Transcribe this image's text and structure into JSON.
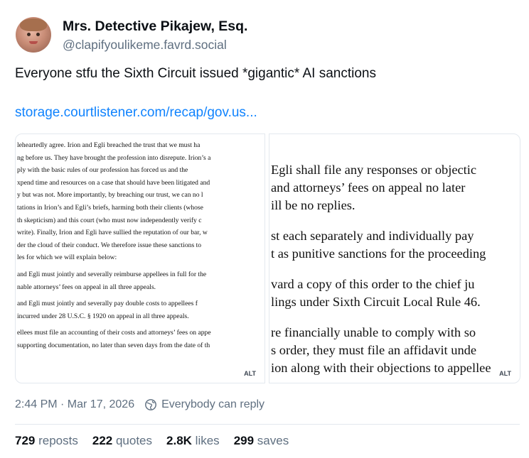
{
  "author": {
    "display_name": "Mrs. Detective Pikajew, Esq.",
    "handle": "@clapifyoulikeme.favrd.social",
    "avatar_icon": "avatar-photo"
  },
  "post": {
    "text": "Everyone stfu the Sixth Circuit issued *gigantic* AI sanctions",
    "link": "storage.courtlistener.com/recap/gov.us..."
  },
  "images": [
    {
      "alt_label": "ALT",
      "lines": [
        "leheartedly agree.  Irion and Egli breached the trust that we must ha",
        "ng before us.  They have brought the profession into disrepute.  Irion’s a",
        "ply with the basic rules of our profession has forced us and the",
        "xpend time and resources on a case that should have been litigated and",
        "y but was not.  More importantly, by breaching our trust, we can no l",
        "tations in Irion’s and Egli’s briefs, harming both their clients (whose",
        "th skepticism) and this court (who must now independently verify c",
        "write).  Finally, Irion and Egli have sullied the reputation of our bar, w",
        "der the cloud of their conduct.  We therefore issue these sanctions to",
        "les for which we will explain below:",
        "",
        " and Egli must jointly and severally reimburse appellees in full for the",
        "nable attorneys’ fees on appeal in all three appeals.",
        "",
        " and Egli must jointly and severally pay double costs to appellees f",
        " incurred under 28 U.S.C. § 1920 on appeal in all three appeals.",
        "",
        "ellees must file an accounting of their costs and attorneys’ fees on appe",
        " supporting documentation, no later than seven days from the date of th"
      ]
    },
    {
      "alt_label": "ALT",
      "lines": [
        "Egli shall file any responses or objectic",
        "and attorneys’ fees on appeal no later",
        "ill be no replies.",
        "",
        "st each separately and individually pay",
        "t as punitive sanctions for the proceeding",
        "",
        "vard a copy of this order to the chief ju",
        "lings under Sixth Circuit Local Rule 46.",
        "",
        "re financially unable to comply with so",
        "s order, they must file an affidavit unde",
        "ion along with their objections to appellee"
      ]
    }
  ],
  "meta": {
    "timestamp": "2:44 PM · Mar 17, 2026",
    "reply_setting": "Everybody can reply"
  },
  "stats": {
    "reposts_count": "729",
    "reposts_label": "reposts",
    "quotes_count": "222",
    "quotes_label": "quotes",
    "likes_count": "2.8K",
    "likes_label": "likes",
    "saves_count": "299",
    "saves_label": "saves"
  },
  "colors": {
    "link": "#1083fe",
    "muted": "#5f6f80",
    "border": "#e3e8ee"
  }
}
